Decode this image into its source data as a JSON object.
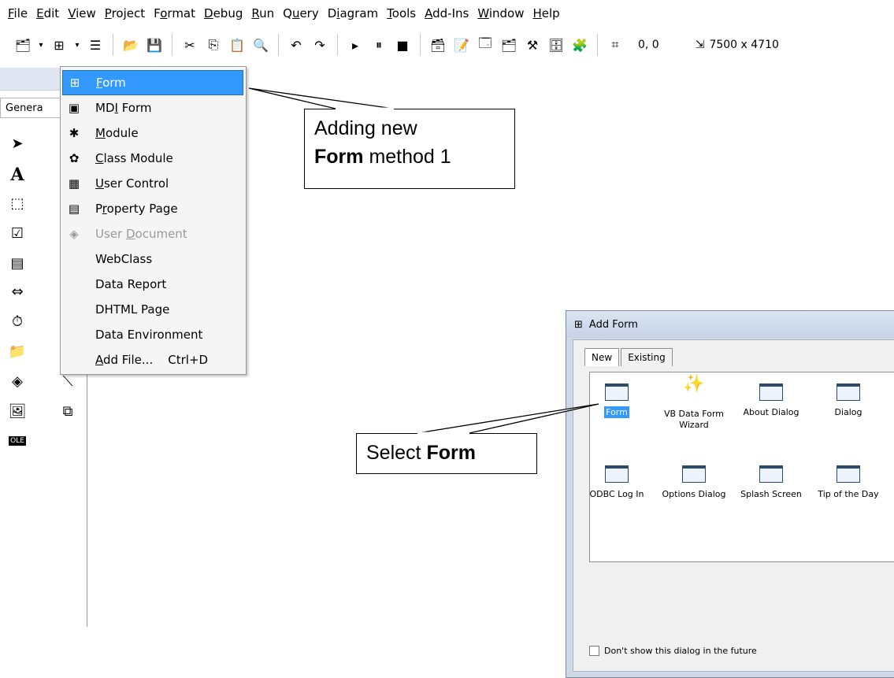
{
  "menubar": {
    "items": [
      {
        "prefix": "",
        "u": "F",
        "rest": "ile"
      },
      {
        "prefix": "",
        "u": "E",
        "rest": "dit"
      },
      {
        "prefix": "",
        "u": "V",
        "rest": "iew"
      },
      {
        "prefix": "",
        "u": "P",
        "rest": "roject"
      },
      {
        "prefix": "F",
        "u": "o",
        "rest": "rmat"
      },
      {
        "prefix": "",
        "u": "D",
        "rest": "ebug"
      },
      {
        "prefix": "",
        "u": "R",
        "rest": "un"
      },
      {
        "prefix": "Q",
        "u": "u",
        "rest": "ery"
      },
      {
        "prefix": "D",
        "u": "i",
        "rest": "agram"
      },
      {
        "prefix": "",
        "u": "T",
        "rest": "ools"
      },
      {
        "prefix": "",
        "u": "A",
        "rest": "dd-Ins"
      },
      {
        "prefix": "",
        "u": "W",
        "rest": "indow"
      },
      {
        "prefix": "",
        "u": "H",
        "rest": "elp"
      }
    ]
  },
  "toolbar": {
    "coords": "0, 0",
    "size": "7500 x 4710"
  },
  "leftpanel": {
    "tab_label": "Genera"
  },
  "menu": {
    "items": [
      {
        "prefix": "",
        "u": "F",
        "rest": "orm",
        "icon": "form-icon",
        "glyph": "⊞",
        "selected": true,
        "disabled": false
      },
      {
        "prefix": "MD",
        "u": "I",
        "rest": " Form",
        "icon": "mdi-form-icon",
        "glyph": "▣",
        "selected": false,
        "disabled": false
      },
      {
        "prefix": "",
        "u": "M",
        "rest": "odule",
        "icon": "module-icon",
        "glyph": "✱",
        "selected": false,
        "disabled": false
      },
      {
        "prefix": "",
        "u": "C",
        "rest": "lass Module",
        "icon": "class-module-icon",
        "glyph": "✿",
        "selected": false,
        "disabled": false
      },
      {
        "prefix": "",
        "u": "U",
        "rest": "ser Control",
        "icon": "user-control-icon",
        "glyph": "▦",
        "selected": false,
        "disabled": false
      },
      {
        "prefix": "P",
        "u": "r",
        "rest": "operty Page",
        "icon": "property-page-icon",
        "glyph": "▤",
        "selected": false,
        "disabled": false
      },
      {
        "prefix": "User ",
        "u": "D",
        "rest": "ocument",
        "icon": "user-document-icon",
        "glyph": "◈",
        "selected": false,
        "disabled": true
      },
      {
        "prefix": "WebClass",
        "u": "",
        "rest": "",
        "icon": "",
        "glyph": "",
        "selected": false,
        "disabled": false
      },
      {
        "prefix": "Data Report",
        "u": "",
        "rest": "",
        "icon": "",
        "glyph": "",
        "selected": false,
        "disabled": false
      },
      {
        "prefix": "DHTML Page",
        "u": "",
        "rest": "",
        "icon": "",
        "glyph": "",
        "selected": false,
        "disabled": false
      },
      {
        "prefix": "Data Environment",
        "u": "",
        "rest": "",
        "icon": "",
        "glyph": "",
        "selected": false,
        "disabled": false
      },
      {
        "prefix": "",
        "u": "A",
        "rest": "dd File...    Ctrl+D",
        "icon": "",
        "glyph": "",
        "selected": false,
        "disabled": false
      }
    ]
  },
  "callouts": {
    "method1_line1": "Adding new",
    "method1_bold": "Form",
    "method1_rest": " method 1",
    "select_prefix": "Select ",
    "select_bold": "Form"
  },
  "dialog": {
    "title": "Add Form",
    "tab_new": "New",
    "tab_existing": "Existing",
    "items": [
      "Form",
      "VB Data Form Wizard",
      "About Dialog",
      "Dialog",
      "ODBC Log In",
      "Options Dialog",
      "Splash Screen",
      "Tip of the Day"
    ],
    "checkbox_label": "Don't show this dialog in the future"
  }
}
